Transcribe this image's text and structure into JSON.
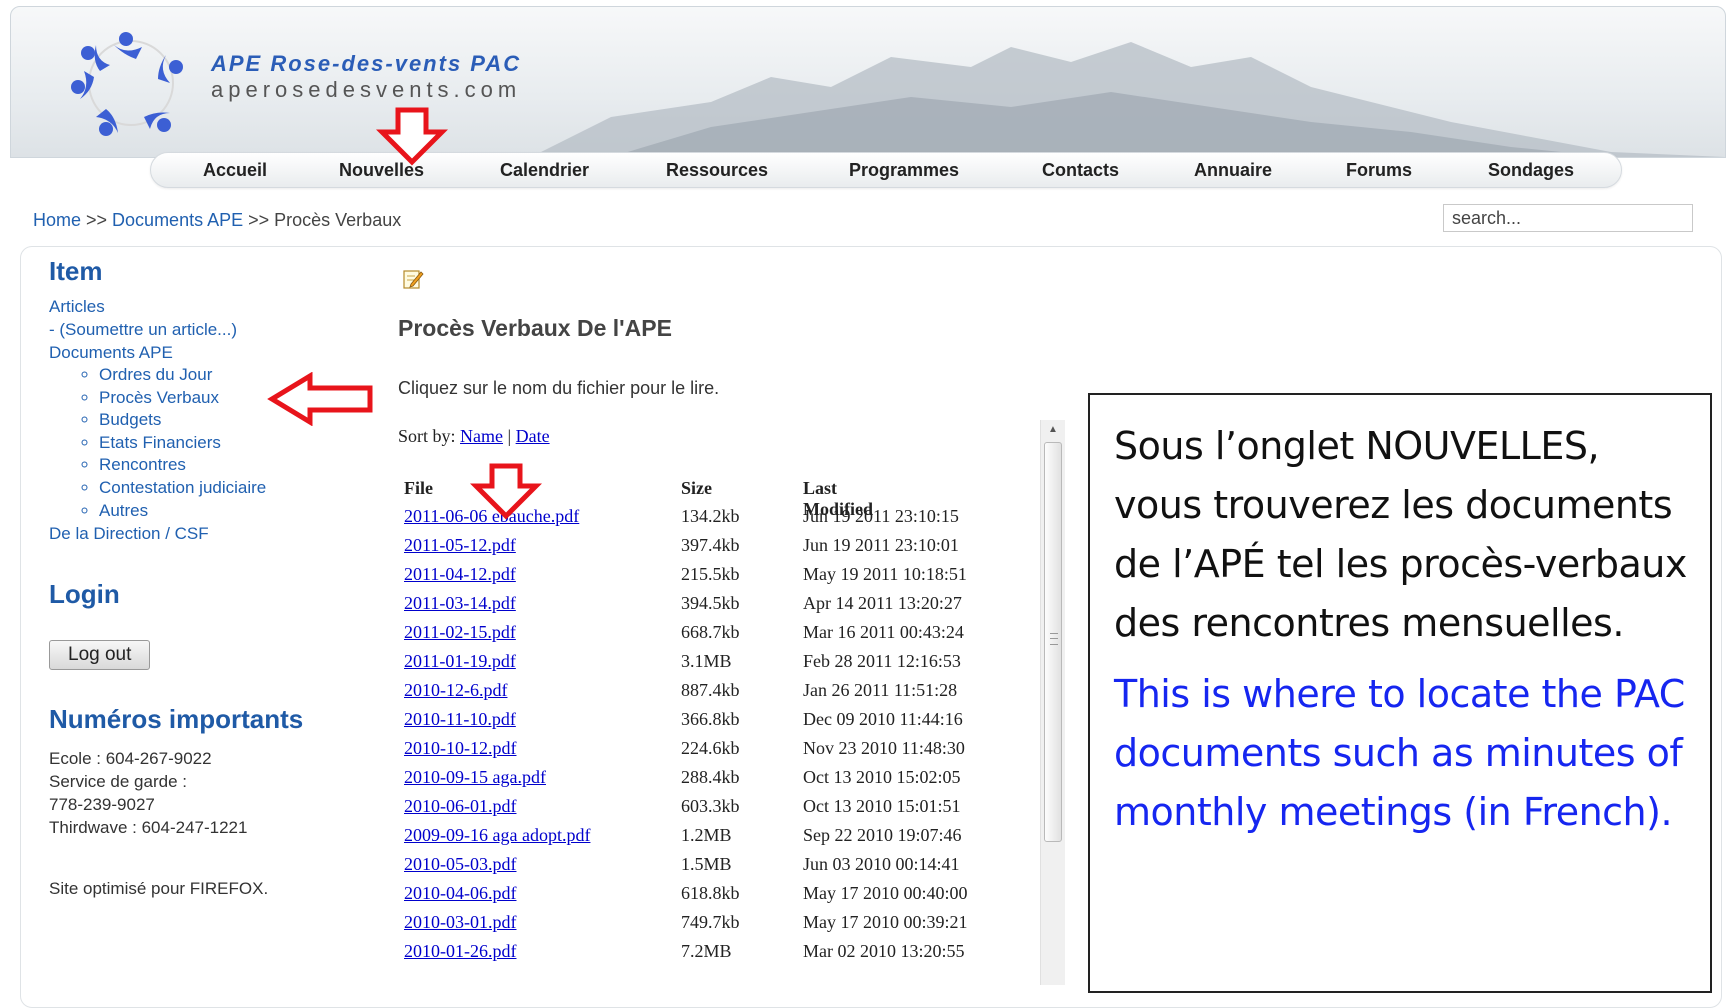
{
  "brand": {
    "title": "APE Rose-des-vents PAC",
    "domain": "aperosedesvents.com"
  },
  "nav": {
    "items": [
      {
        "label": "Accueil"
      },
      {
        "label": "Nouvelles"
      },
      {
        "label": "Calendrier"
      },
      {
        "label": "Ressources"
      },
      {
        "label": "Programmes"
      },
      {
        "label": "Contacts"
      },
      {
        "label": "Annuaire"
      },
      {
        "label": "Forums"
      },
      {
        "label": "Sondages"
      }
    ]
  },
  "breadcrumb": {
    "home": "Home",
    "sep1": " >> ",
    "section": "Documents APE",
    "sep2": " >> ",
    "current": "Procès Verbaux"
  },
  "search": {
    "value": "search..."
  },
  "sidebar": {
    "item_heading": "Item",
    "articles": "Articles",
    "submit_article": "- (Soumettre un article...)",
    "documents": "Documents APE",
    "sub_items": [
      "Ordres du Jour",
      "Procès Verbaux",
      "Budgets",
      "Etats Financiers",
      "Rencontres",
      "Contestation judiciaire",
      "Autres"
    ],
    "direction": "De la Direction / CSF",
    "login_heading": "Login",
    "logout_label": "Log out",
    "numbers_heading": "Numéros importants",
    "phones": [
      "Ecole : 604-267-9022",
      "Service de garde :",
      "778-239-9027",
      "Thirdwave :  604-247-1221"
    ],
    "footer_note": "Site optimisé pour FIREFOX."
  },
  "main": {
    "title": "Procès Verbaux De l'APE",
    "intro": "Cliquez sur le nom du fichier pour le lire.",
    "sort_label": "Sort by:",
    "sort_name": "Name",
    "sort_sep": "|",
    "sort_date": "Date",
    "columns": {
      "file": "File",
      "size": "Size",
      "modified": "Last Modified"
    },
    "files": [
      {
        "name": "2011-06-06 ebauche.pdf",
        "size": "134.2kb",
        "date": "Jun 19 2011 23:10:15"
      },
      {
        "name": "2011-05-12.pdf",
        "size": "397.4kb",
        "date": "Jun 19 2011 23:10:01"
      },
      {
        "name": "2011-04-12.pdf",
        "size": "215.5kb",
        "date": "May 19 2011 10:18:51"
      },
      {
        "name": "2011-03-14.pdf",
        "size": "394.5kb",
        "date": "Apr 14 2011 13:20:27"
      },
      {
        "name": "2011-02-15.pdf",
        "size": "668.7kb",
        "date": "Mar 16 2011 00:43:24"
      },
      {
        "name": "2011-01-19.pdf",
        "size": "3.1MB",
        "date": "Feb 28 2011 12:16:53"
      },
      {
        "name": "2010-12-6.pdf",
        "size": "887.4kb",
        "date": "Jan 26 2011 11:51:28"
      },
      {
        "name": "2010-11-10.pdf",
        "size": "366.8kb",
        "date": "Dec 09 2010 11:44:16"
      },
      {
        "name": "2010-10-12.pdf",
        "size": "224.6kb",
        "date": "Nov 23 2010 11:48:30"
      },
      {
        "name": "2010-09-15 aga.pdf",
        "size": "288.4kb",
        "date": "Oct 13 2010 15:02:05"
      },
      {
        "name": "2010-06-01.pdf",
        "size": "603.3kb",
        "date": "Oct 13 2010 15:01:51"
      },
      {
        "name": "2009-09-16 aga adopt.pdf",
        "size": "1.2MB",
        "date": "Sep 22 2010 19:07:46"
      },
      {
        "name": "2010-05-03.pdf",
        "size": "1.5MB",
        "date": "Jun 03 2010 00:14:41"
      },
      {
        "name": "2010-04-06.pdf",
        "size": "618.8kb",
        "date": "May 17 2010 00:40:00"
      },
      {
        "name": "2010-03-01.pdf",
        "size": "749.7kb",
        "date": "May 17 2010 00:39:21"
      },
      {
        "name": "2010-01-26.pdf",
        "size": "7.2MB",
        "date": "Mar 02 2010 13:20:55"
      }
    ]
  },
  "callout": {
    "french": "Sous l’onglet NOUVELLES, vous trouverez les documents de l’APÉ tel les procès-verbaux des rencontres mensuelles.",
    "english": "This is where to locate the PAC documents such as minutes of monthly meetings (in French).",
    "english_color": "#1626f0"
  },
  "colors": {
    "link": "#2060b0",
    "file_link": "#0000cc",
    "heading": "#1f5aa6",
    "annotation_arrow": "#e8141b"
  }
}
